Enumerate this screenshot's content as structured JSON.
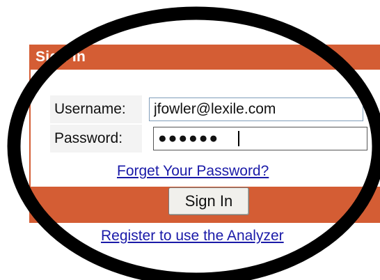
{
  "login": {
    "header_title": "Sign In",
    "username_label": "Username:",
    "username_value": "jfowler@lexile.com",
    "password_label": "Password:",
    "password_masked": "●●●●●●",
    "forgot_link": "Forget Your Password?",
    "signin_button": "Sign In"
  },
  "register_link": "Register to use the Analyzer",
  "colors": {
    "panel_orange": "#d45d34",
    "link_blue": "#1a1aa8",
    "circle_black": "#000000"
  }
}
